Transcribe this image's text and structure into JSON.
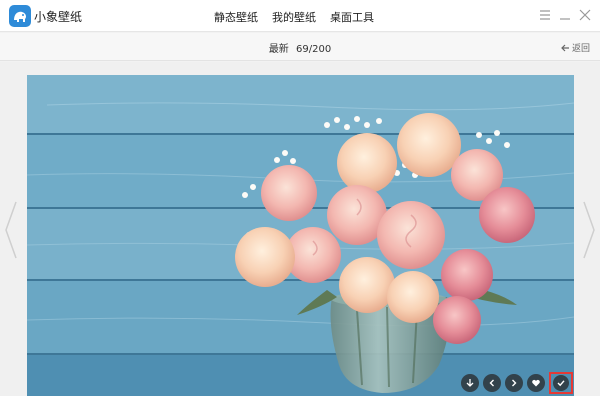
{
  "app": {
    "name": "小象壁纸"
  },
  "nav": {
    "items": [
      "静态壁纸",
      "我的壁纸",
      "桌面工具"
    ]
  },
  "subbar": {
    "category": "最新",
    "counter": "69/200",
    "back_label": "返回"
  },
  "icons": {
    "logo": "elephant-logo-icon",
    "menu": "menu-icon",
    "minimize": "minimize-icon",
    "close": "close-icon",
    "back": "back-arrow-icon",
    "prev": "chevron-left-icon",
    "next": "chevron-right-icon",
    "download": "download-icon",
    "favorite": "heart-icon",
    "set": "check-icon"
  },
  "colors": {
    "accent": "#2e8bd8",
    "highlight": "#e53935",
    "wood": "#6ea9c6"
  }
}
